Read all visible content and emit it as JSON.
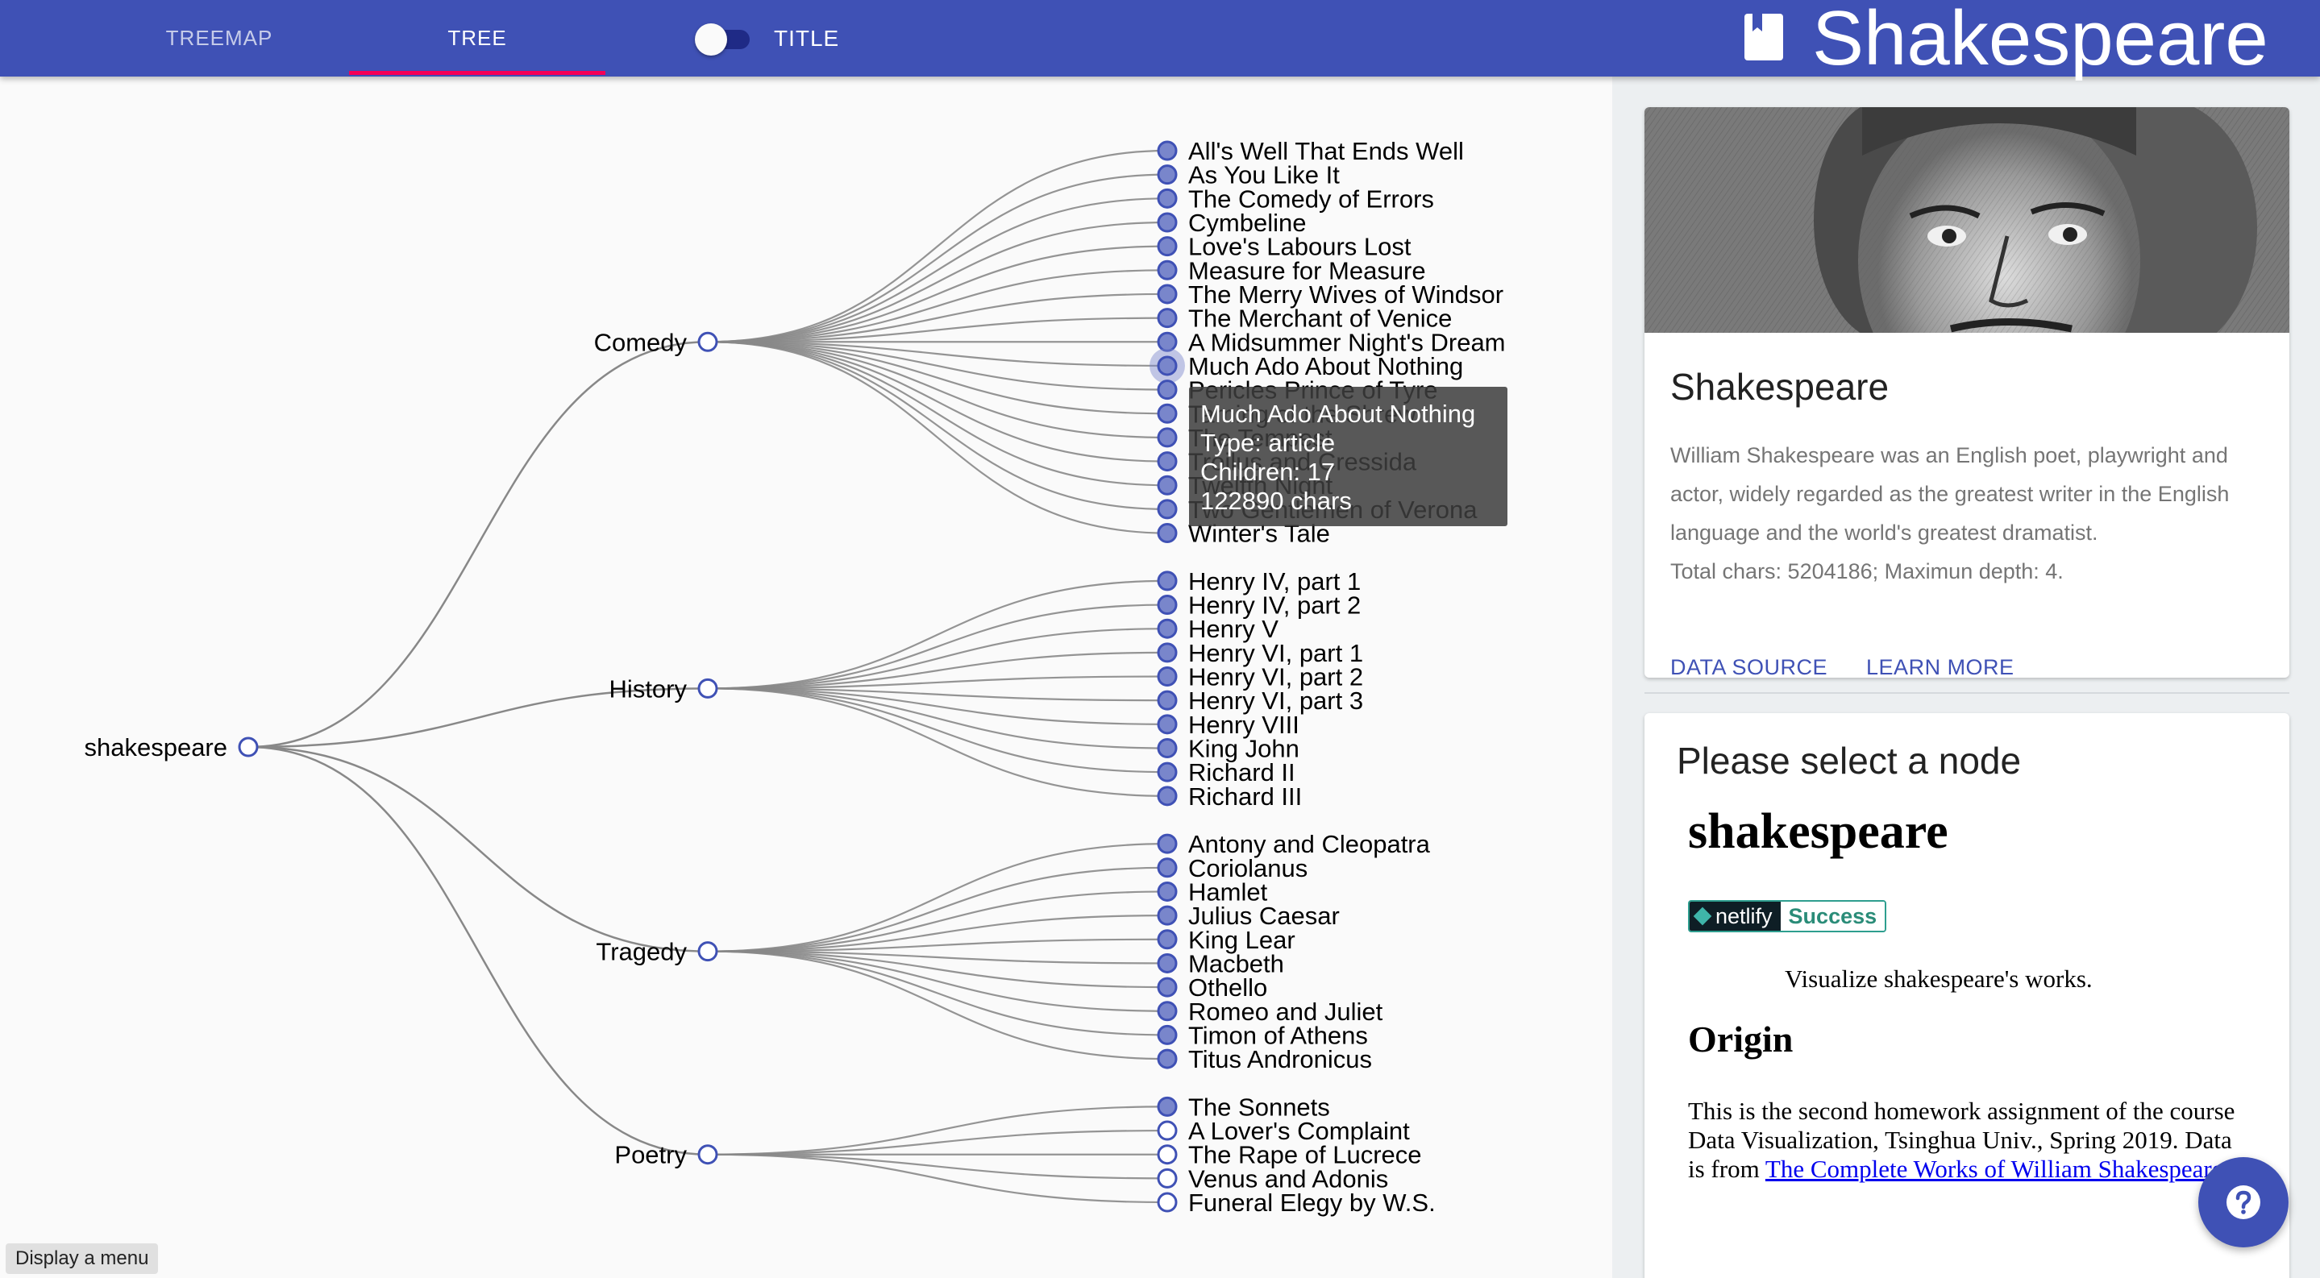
{
  "appbar": {
    "tabs": [
      "TREEMAP",
      "TREE"
    ],
    "active_tab": "TREE",
    "toggle_label": "TITLE",
    "toggle_on": false,
    "brand": "Shakespeare",
    "brand_icon": "book-icon"
  },
  "colors": {
    "primary": "#3f51b5",
    "accent": "#f50057",
    "node_fill": "#7986cb",
    "node_stroke": "#3f51b5",
    "link": "#888888"
  },
  "tree": {
    "root": "shakespeare",
    "groups": [
      {
        "name": "Comedy",
        "children": [
          "All's Well That Ends Well",
          "As You Like It",
          "The Comedy of Errors",
          "Cymbeline",
          "Love's Labours Lost",
          "Measure for Measure",
          "The Merry Wives of Windsor",
          "The Merchant of Venice",
          "A Midsummer Night's Dream",
          "Much Ado About Nothing",
          "Pericles Prince of Tyre",
          "Taming of the Shrew",
          "The Tempest",
          "Troilus and Cressida",
          "Twelfth Night",
          "Two Gentlemen of Verona",
          "Winter's Tale"
        ]
      },
      {
        "name": "History",
        "children": [
          "Henry IV, part 1",
          "Henry IV, part 2",
          "Henry V",
          "Henry VI, part 1",
          "Henry VI, part 2",
          "Henry VI, part 3",
          "Henry VIII",
          "King John",
          "Richard II",
          "Richard III"
        ]
      },
      {
        "name": "Tragedy",
        "children": [
          "Antony and Cleopatra",
          "Coriolanus",
          "Hamlet",
          "Julius Caesar",
          "King Lear",
          "Macbeth",
          "Othello",
          "Romeo and Juliet",
          "Timon of Athens",
          "Titus Andronicus"
        ]
      },
      {
        "name": "Poetry",
        "children": [
          "The Sonnets",
          "A Lover's Complaint",
          "The Rape of Lucrece",
          "Venus and Adonis",
          "Funeral Elegy by W.S."
        ],
        "filled": [
          true,
          false,
          false,
          false,
          false
        ]
      }
    ],
    "hovered": "Much Ado About Nothing"
  },
  "tooltip": {
    "title": "Much Ado About Nothing",
    "type": "Type: article",
    "children": "Children: 17",
    "chars": "122890 chars"
  },
  "menu_hint": "Display a menu",
  "info_card": {
    "title": "Shakespeare",
    "description": "William Shakespeare was an English poet, playwright and actor, widely regarded as the greatest writer in the English language and the world's greatest dramatist.",
    "stats": "Total chars: 5204186; Maximun depth: 4.",
    "actions": [
      "DATA SOURCE",
      "LEARN MORE"
    ]
  },
  "detail_card": {
    "heading": "Please select a node",
    "title": "shakespeare",
    "badge_left": "netlify",
    "badge_right": "Success",
    "tagline": "Visualize shakespeare's works.",
    "origin_heading": "Origin",
    "origin_text": "This is the second homework assignment of the course Data Visualization, Tsinghua Univ., Spring 2019. Data is from ",
    "origin_link": "The Complete Works of William Shakespeare",
    "origin_end": "."
  },
  "fab_icon": "help-icon"
}
